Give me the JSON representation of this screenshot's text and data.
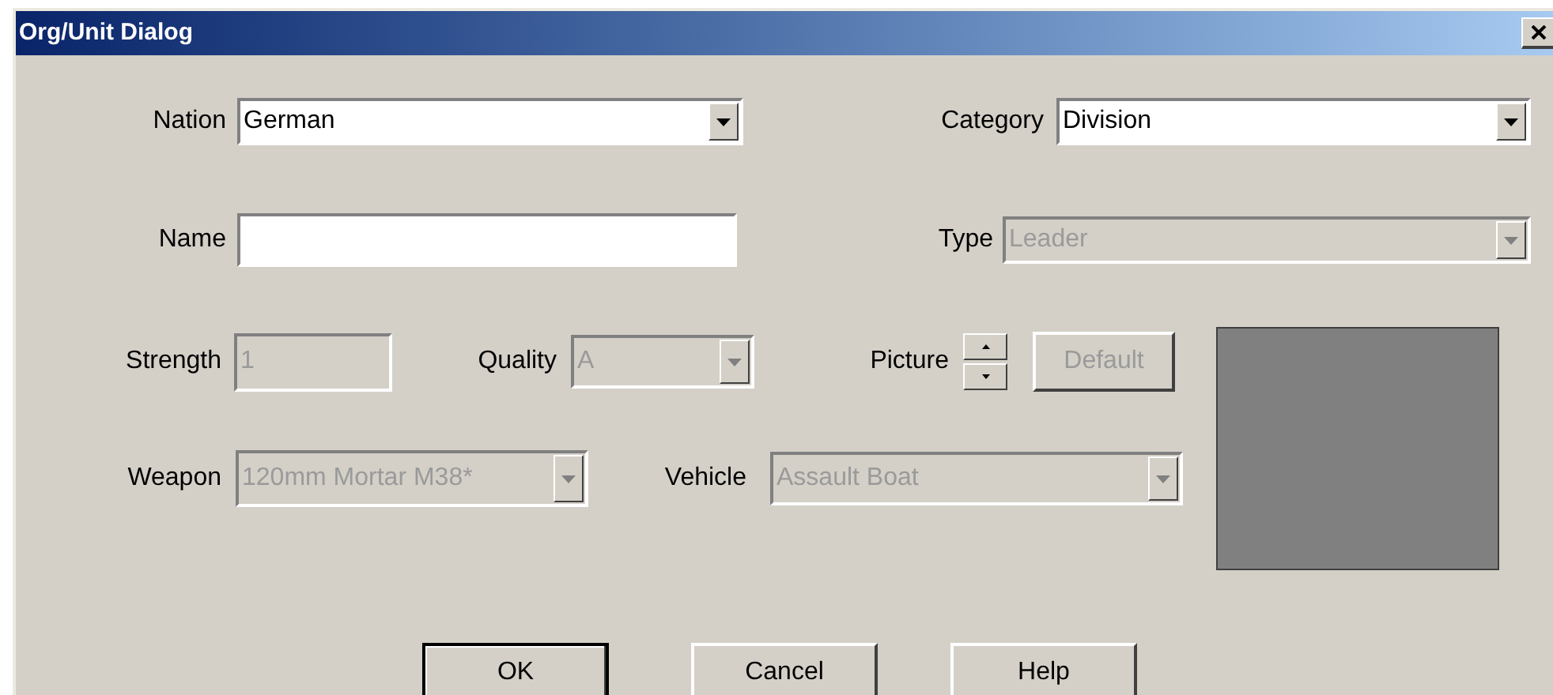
{
  "window": {
    "title": "Org/Unit Dialog"
  },
  "rows": [
    [
      {
        "label": "Nation",
        "kind": "combo",
        "value": "German",
        "disabled": false
      },
      {
        "label": "Category",
        "kind": "combo",
        "value": "Division",
        "disabled": false
      }
    ],
    [
      {
        "label": "Name",
        "kind": "text",
        "disabled": false
      },
      {
        "label": "Type",
        "kind": "combo",
        "value": "Leader",
        "disabled": true
      }
    ],
    [
      {
        "label": "Strength",
        "kind": "text",
        "value": "1",
        "disabled": true
      },
      {
        "label": "Quality",
        "kind": "combo",
        "value": "A",
        "disabled": true
      },
      {
        "label": "Picture",
        "kind": "spin",
        "disabled": false,
        "button": {
          "label": "Default",
          "disabled": true
        }
      }
    ],
    [
      {
        "label": "Weapon",
        "kind": "combo",
        "value": "120mm Mortar M38*",
        "disabled": true
      },
      {
        "label": "Vehicle",
        "kind": "combo",
        "value": "Assault Boat",
        "disabled": true
      }
    ]
  ],
  "buttons": [
    {
      "label": "OK",
      "default": true
    },
    {
      "label": "Cancel",
      "default": false
    },
    {
      "label": "Help",
      "default": false
    }
  ]
}
